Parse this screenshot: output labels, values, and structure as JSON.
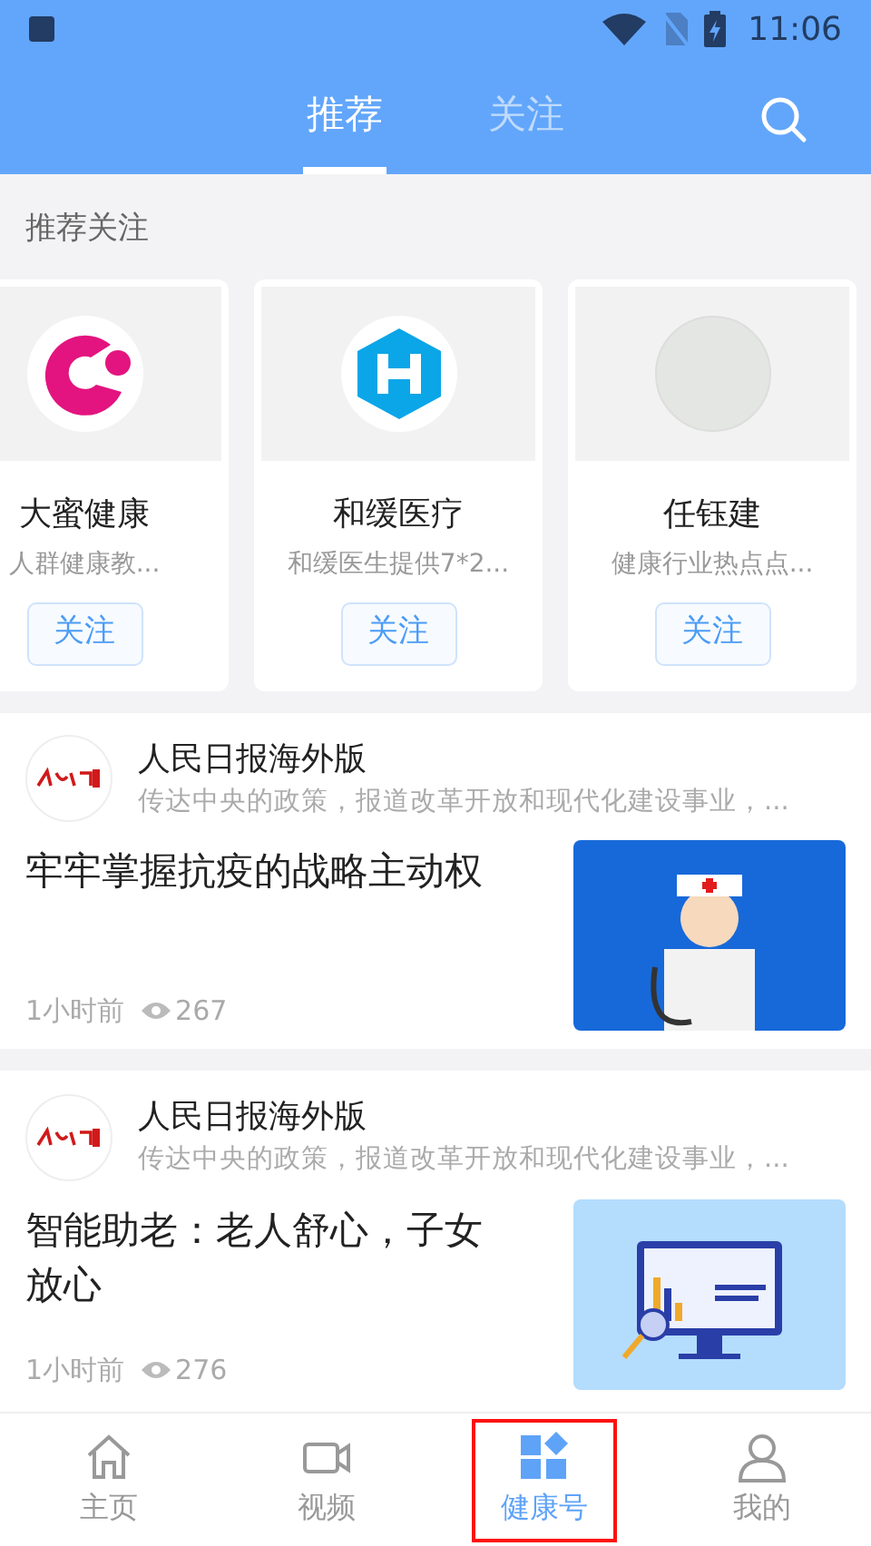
{
  "status_bar": {
    "time": "11:06"
  },
  "tabs": [
    {
      "label": "推荐",
      "selected": true
    },
    {
      "label": "关注",
      "selected": false
    }
  ],
  "recommend": {
    "title": "推荐关注",
    "cards": [
      {
        "name": "大蜜健康",
        "description": "人群健康教...",
        "button": "关注"
      },
      {
        "name": "和缓医疗",
        "description": "和缓医生提供7*2...",
        "button": "关注"
      },
      {
        "name": "任钰建",
        "description": "健康行业热点点...",
        "button": "关注"
      }
    ]
  },
  "articles": [
    {
      "source": "人民日报海外版",
      "source_description": "传达中央的政策，报道改革开放和现代化建设事业，...",
      "title": "牢牢掌握抗疫的战略主动权",
      "time": "1小时前",
      "views": "267"
    },
    {
      "source": "人民日报海外版",
      "source_description": "传达中央的政策，报道改革开放和现代化建设事业，...",
      "title": "智能助老：老人舒心，子女放心",
      "time": "1小时前",
      "views": "276"
    }
  ],
  "bottom_nav": [
    {
      "label": "主页",
      "selected": false,
      "highlighted": false
    },
    {
      "label": "视频",
      "selected": false,
      "highlighted": false
    },
    {
      "label": "健康号",
      "selected": true,
      "highlighted": true
    },
    {
      "label": "我的",
      "selected": false,
      "highlighted": false
    }
  ]
}
